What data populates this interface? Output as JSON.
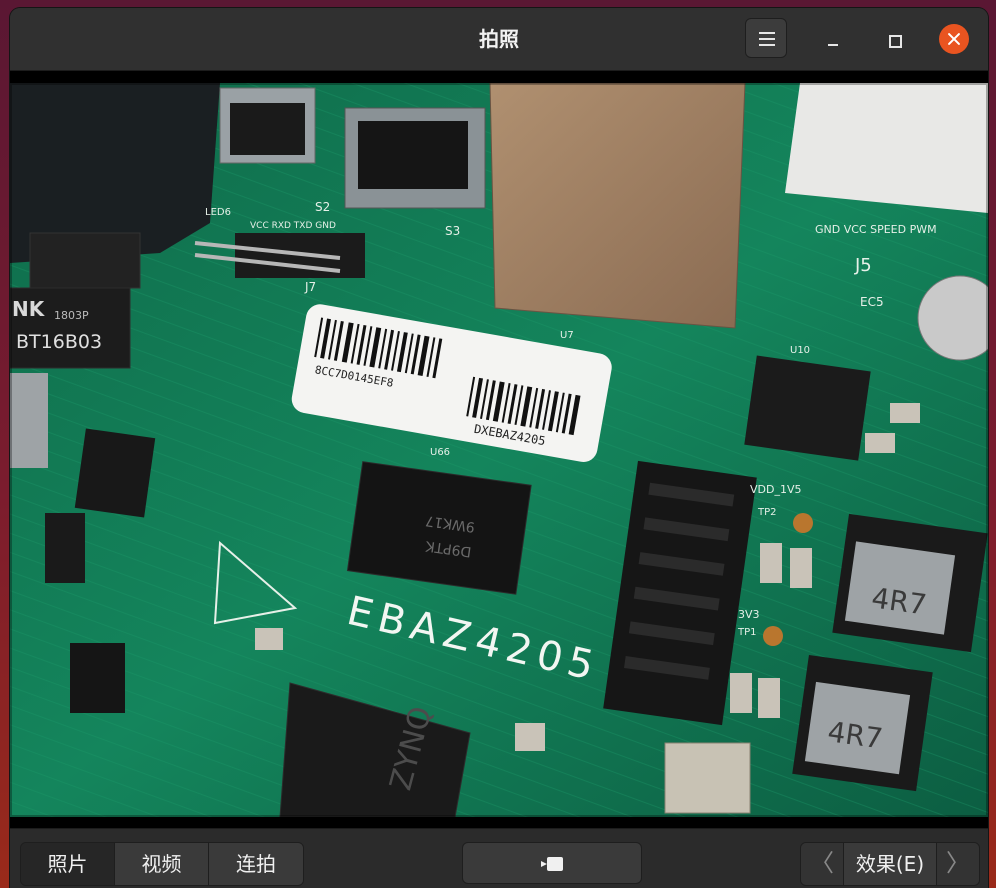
{
  "window": {
    "title": "拍照"
  },
  "modes": [
    {
      "label": "照片",
      "active": true
    },
    {
      "label": "视频",
      "active": false
    },
    {
      "label": "连拍",
      "active": false
    }
  ],
  "effects": {
    "label": "效果(E)",
    "prev": "〈",
    "next": "〉"
  },
  "board": {
    "brand_text": "EBAZ4205",
    "sticker_code": "8CC7D0145EF8",
    "sticker_model": "DXEBAZ4205",
    "chip_marking_1": "9WK17",
    "chip_marking_2": "D9PTK",
    "inductor_1": "4R7",
    "inductor_2": "4R7",
    "zynq_text": "ZYNQ",
    "transformer_text_1": "BT16B03",
    "transformer_text_2": "1803P",
    "transformer_brand": "NK",
    "connector_j5": "J5",
    "connector_j7": "J7",
    "switch_s2": "S2",
    "switch_s3": "S3",
    "label_led6": "LED6",
    "label_u66": "U66",
    "label_u7": "U7",
    "label_u10": "U10",
    "label_ec5": "EC5",
    "label_3v3": "3V3",
    "label_tp1": "TP1",
    "label_tp2": "TP2",
    "label_vdd": "VDD_1V5",
    "label_j5_pins": "GND  VCC  SPEED  PWM",
    "label_j7_pins": "VCC  RXD  TXD  GND"
  },
  "colors": {
    "pcb": "#12805a",
    "accent_close": "#e95420"
  }
}
